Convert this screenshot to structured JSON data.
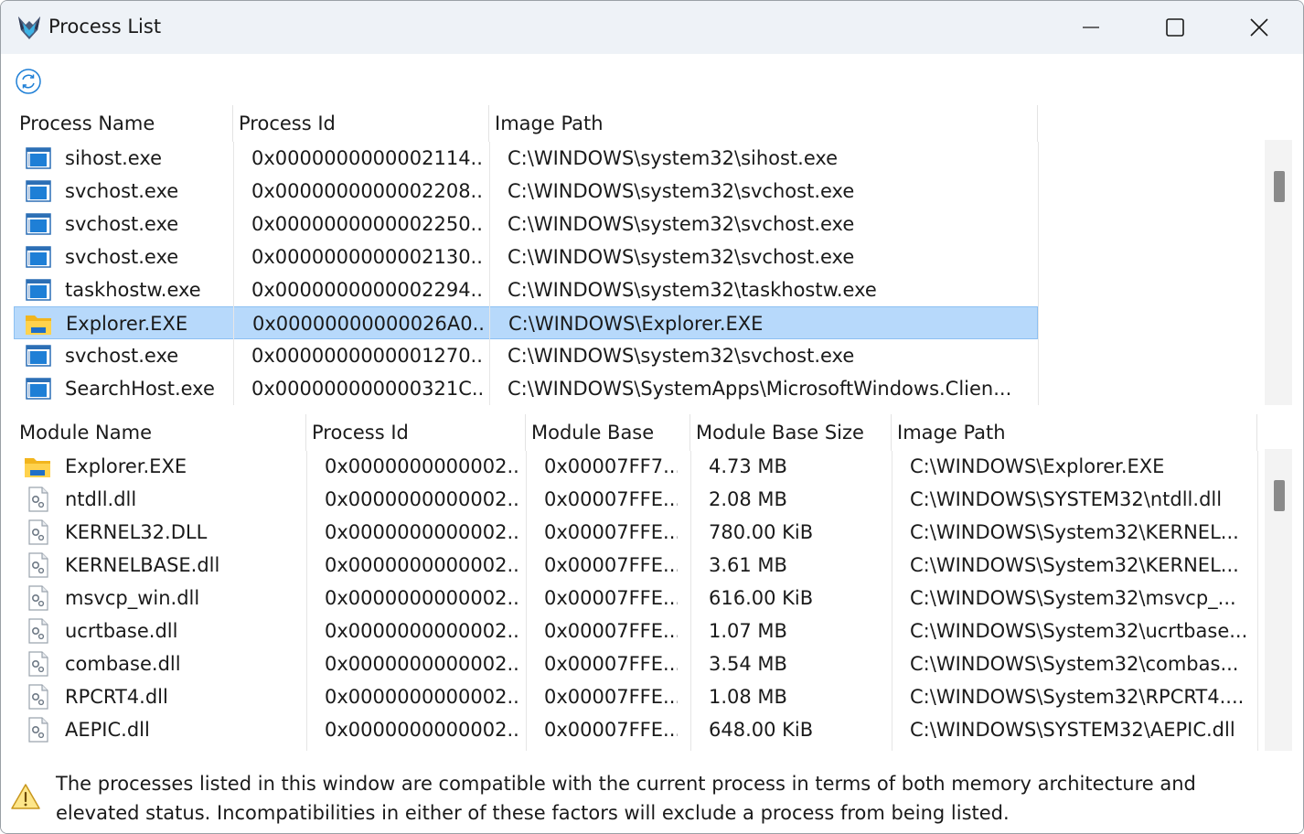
{
  "window": {
    "title": "Process List",
    "minimize_glyph": "—",
    "colors": {
      "titlebar": "#eef2f7",
      "selection": "#b7d9fb",
      "accent": "#1e7fd6"
    }
  },
  "toolbar": {
    "refresh_icon": "refresh-icon"
  },
  "process_table": {
    "columns": [
      "Process Name",
      "Process Id",
      "Image Path"
    ],
    "rows": [
      {
        "icon": "app-window-icon",
        "name": "sihost.exe",
        "pid": "0x0000000000002114...",
        "path": "C:\\WINDOWS\\system32\\sihost.exe"
      },
      {
        "icon": "app-window-icon",
        "name": "svchost.exe",
        "pid": "0x0000000000002208...",
        "path": "C:\\WINDOWS\\system32\\svchost.exe"
      },
      {
        "icon": "app-window-icon",
        "name": "svchost.exe",
        "pid": "0x0000000000002250...",
        "path": "C:\\WINDOWS\\system32\\svchost.exe"
      },
      {
        "icon": "app-window-icon",
        "name": "svchost.exe",
        "pid": "0x0000000000002130...",
        "path": "C:\\WINDOWS\\system32\\svchost.exe"
      },
      {
        "icon": "app-window-icon",
        "name": "taskhostw.exe",
        "pid": "0x0000000000002294...",
        "path": "C:\\WINDOWS\\system32\\taskhostw.exe"
      },
      {
        "icon": "folder-icon",
        "name": "Explorer.EXE",
        "pid": "0x00000000000026A0...",
        "path": "C:\\WINDOWS\\Explorer.EXE",
        "selected": true
      },
      {
        "icon": "app-window-icon",
        "name": "svchost.exe",
        "pid": "0x0000000000001270...",
        "path": "C:\\WINDOWS\\system32\\svchost.exe"
      },
      {
        "icon": "app-window-icon",
        "name": "SearchHost.exe",
        "pid": "0x000000000000321C...",
        "path": "C:\\WINDOWS\\SystemApps\\MicrosoftWindows.Clien..."
      }
    ]
  },
  "module_table": {
    "columns": [
      "Module Name",
      "Process Id",
      "Module Base",
      "Module Base Size",
      "Image Path"
    ],
    "rows": [
      {
        "icon": "folder-icon",
        "name": "Explorer.EXE",
        "pid": "0x0000000000002...",
        "base": "0x00007FF7...",
        "size": "4.73 MB",
        "path": "C:\\WINDOWS\\Explorer.EXE"
      },
      {
        "icon": "dll-file-icon",
        "name": "ntdll.dll",
        "pid": "0x0000000000002...",
        "base": "0x00007FFE...",
        "size": "2.08 MB",
        "path": "C:\\WINDOWS\\SYSTEM32\\ntdll.dll"
      },
      {
        "icon": "dll-file-icon",
        "name": "KERNEL32.DLL",
        "pid": "0x0000000000002...",
        "base": "0x00007FFE...",
        "size": "780.00 KiB",
        "path": "C:\\WINDOWS\\System32\\KERNEL..."
      },
      {
        "icon": "dll-file-icon",
        "name": "KERNELBASE.dll",
        "pid": "0x0000000000002...",
        "base": "0x00007FFE...",
        "size": "3.61 MB",
        "path": "C:\\WINDOWS\\System32\\KERNEL..."
      },
      {
        "icon": "dll-file-icon",
        "name": "msvcp_win.dll",
        "pid": "0x0000000000002...",
        "base": "0x00007FFE...",
        "size": "616.00 KiB",
        "path": "C:\\WINDOWS\\System32\\msvcp_..."
      },
      {
        "icon": "dll-file-icon",
        "name": "ucrtbase.dll",
        "pid": "0x0000000000002...",
        "base": "0x00007FFE...",
        "size": "1.07 MB",
        "path": "C:\\WINDOWS\\System32\\ucrtbase..."
      },
      {
        "icon": "dll-file-icon",
        "name": "combase.dll",
        "pid": "0x0000000000002...",
        "base": "0x00007FFE...",
        "size": "3.54 MB",
        "path": "C:\\WINDOWS\\System32\\combas..."
      },
      {
        "icon": "dll-file-icon",
        "name": "RPCRT4.dll",
        "pid": "0x0000000000002...",
        "base": "0x00007FFE...",
        "size": "1.08 MB",
        "path": "C:\\WINDOWS\\System32\\RPCRT4...."
      },
      {
        "icon": "dll-file-icon",
        "name": "AEPIC.dll",
        "pid": "0x0000000000002...",
        "base": "0x00007FFE...",
        "size": "648.00 KiB",
        "path": "C:\\WINDOWS\\SYSTEM32\\AEPIC.dll"
      }
    ]
  },
  "footer": {
    "icon": "warning-icon",
    "message": "The processes listed in this window are compatible with the current process in terms of both memory architecture and elevated status. Incompatibilities in either of these factors will exclude a process from being listed."
  }
}
